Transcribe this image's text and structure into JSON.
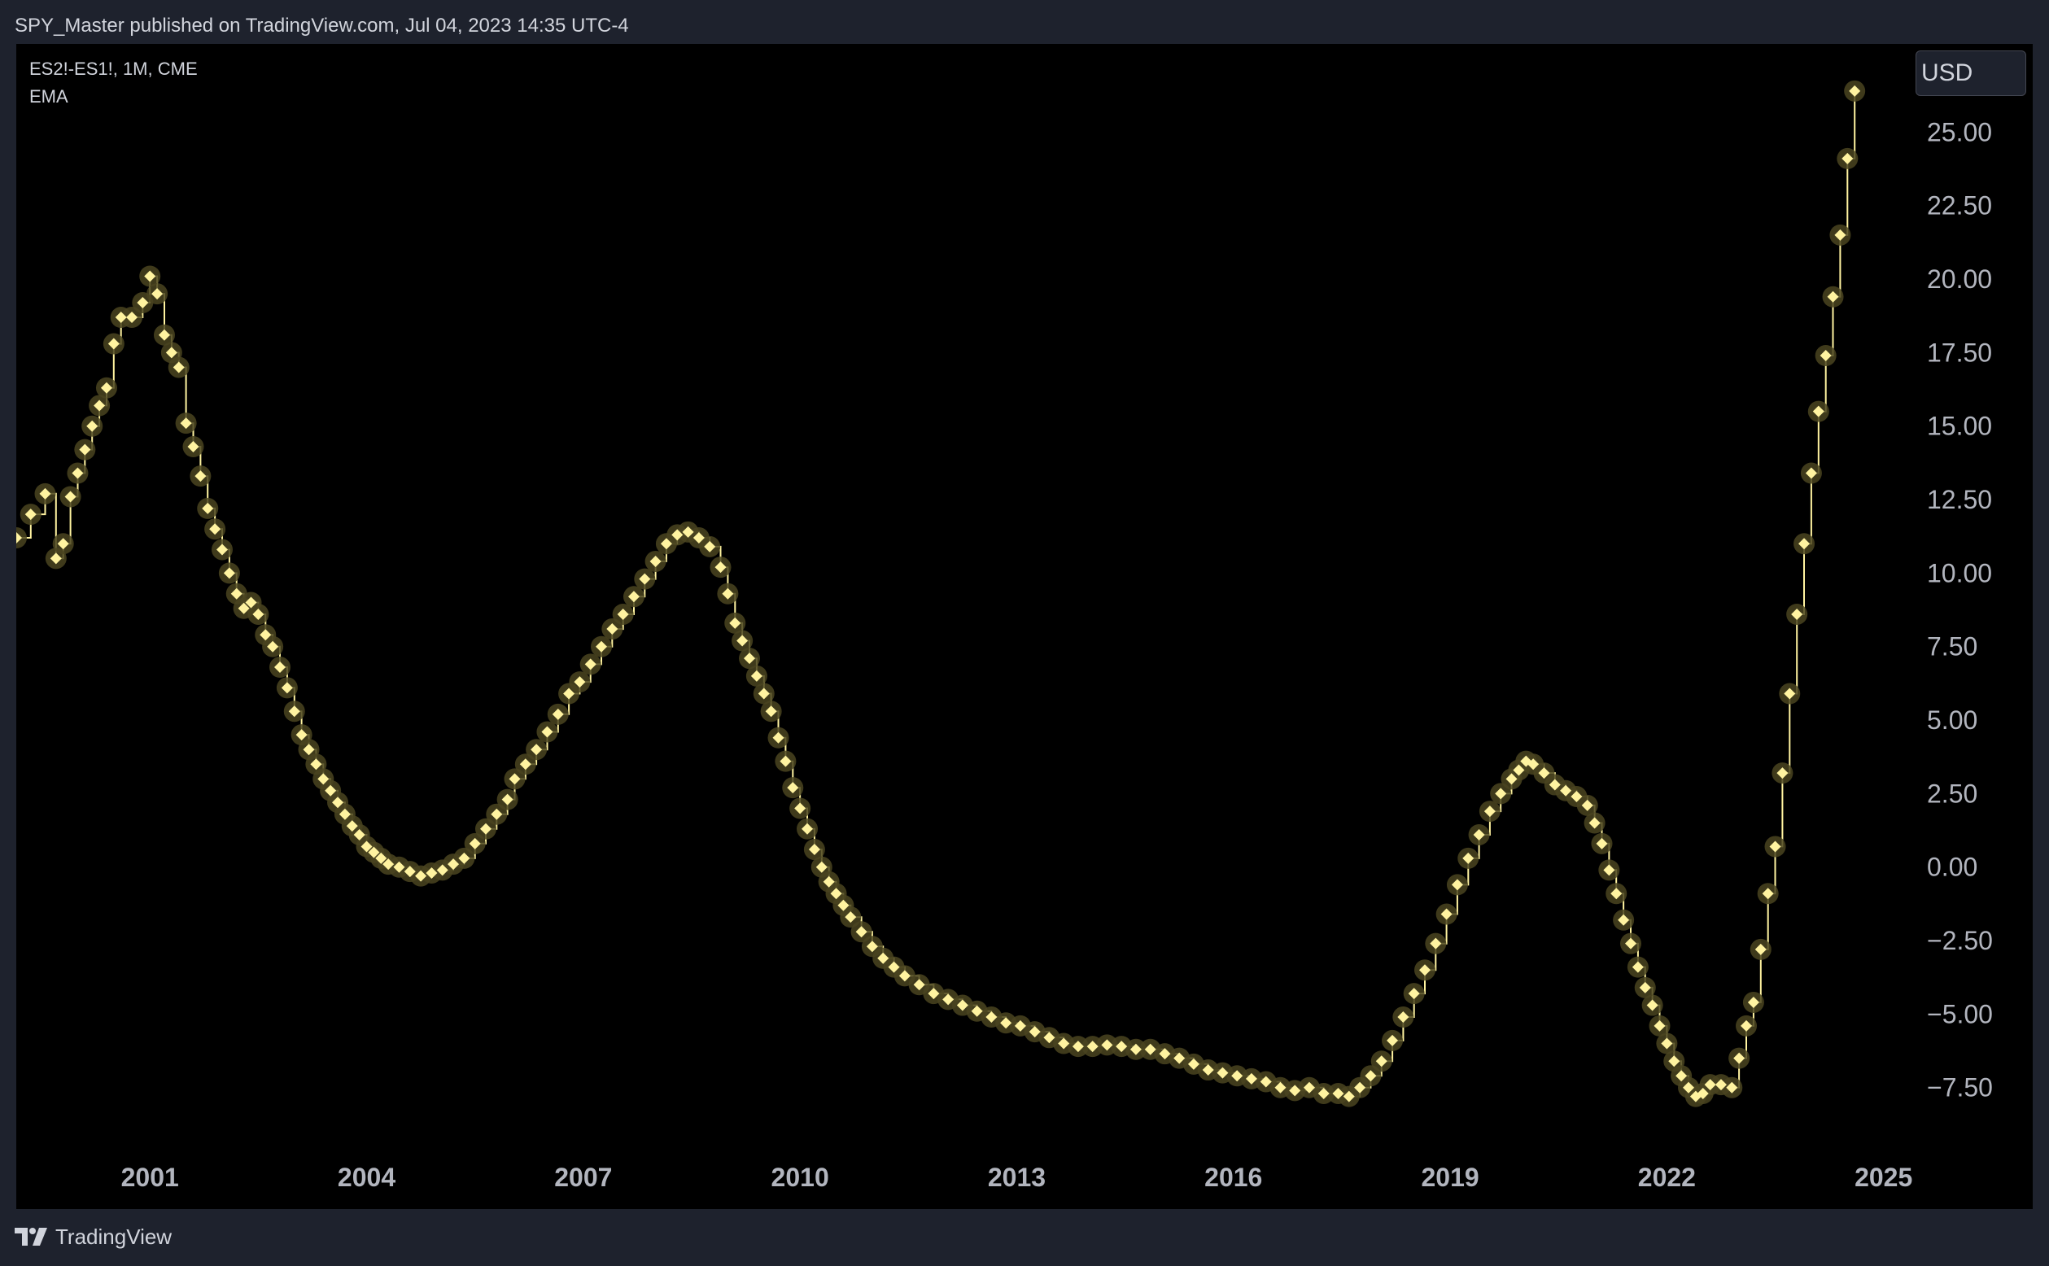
{
  "header": {
    "published_text": "SPY_Master published on TradingView.com, Jul 04, 2023 14:35 UTC-4"
  },
  "legend": {
    "symbol": "ES2!-ES1!, 1M, CME",
    "indicator": "EMA"
  },
  "price_scale": {
    "currency": "USD"
  },
  "footer": {
    "brand": "TradingView",
    "logo_icon": "tradingview-logo-icon"
  },
  "colors": {
    "background": "#1e222d",
    "plot_background": "#000000",
    "line": "#fff3a0",
    "marker_glow": "#4a4420",
    "text": "#d1d4dc",
    "axis_text": "#b2b5be"
  },
  "chart_data": {
    "type": "line",
    "title": "",
    "xlabel": "",
    "ylabel": "",
    "x_ticks": [
      "2001",
      "2004",
      "2007",
      "2010",
      "2013",
      "2016",
      "2019",
      "2022",
      "2025"
    ],
    "y_ticks": [
      "25.00",
      "22.50",
      "20.00",
      "17.50",
      "15.00",
      "12.50",
      "10.00",
      "7.50",
      "5.00",
      "2.50",
      "0.00",
      "−2.50",
      "−5.00",
      "−7.50"
    ],
    "xlim": [
      1999.7,
      2025.7
    ],
    "ylim": [
      -9.5,
      28.0
    ],
    "grid": false,
    "series": [
      {
        "marker": "diamond",
        "points": [
          [
            1999.7,
            11.2
          ],
          [
            1999.9,
            12.0
          ],
          [
            2000.1,
            12.7
          ],
          [
            2000.25,
            10.5
          ],
          [
            2000.35,
            11.0
          ],
          [
            2000.45,
            12.6
          ],
          [
            2000.55,
            13.4
          ],
          [
            2000.65,
            14.2
          ],
          [
            2000.75,
            15.0
          ],
          [
            2000.85,
            15.7
          ],
          [
            2000.95,
            16.3
          ],
          [
            2001.05,
            17.8
          ],
          [
            2001.15,
            18.7
          ],
          [
            2001.3,
            18.7
          ],
          [
            2001.45,
            19.2
          ],
          [
            2001.55,
            20.1
          ],
          [
            2001.65,
            19.5
          ],
          [
            2001.75,
            18.1
          ],
          [
            2001.85,
            17.5
          ],
          [
            2001.95,
            17.0
          ],
          [
            2002.05,
            15.1
          ],
          [
            2002.15,
            14.3
          ],
          [
            2002.25,
            13.3
          ],
          [
            2002.35,
            12.2
          ],
          [
            2002.45,
            11.5
          ],
          [
            2002.55,
            10.8
          ],
          [
            2002.65,
            10.0
          ],
          [
            2002.75,
            9.3
          ],
          [
            2002.85,
            8.8
          ],
          [
            2002.95,
            9.0
          ],
          [
            2003.05,
            8.6
          ],
          [
            2003.15,
            7.9
          ],
          [
            2003.25,
            7.5
          ],
          [
            2003.35,
            6.8
          ],
          [
            2003.45,
            6.1
          ],
          [
            2003.55,
            5.3
          ],
          [
            2003.65,
            4.5
          ],
          [
            2003.75,
            4.0
          ],
          [
            2003.85,
            3.5
          ],
          [
            2003.95,
            3.0
          ],
          [
            2004.05,
            2.6
          ],
          [
            2004.15,
            2.2
          ],
          [
            2004.25,
            1.8
          ],
          [
            2004.35,
            1.4
          ],
          [
            2004.45,
            1.1
          ],
          [
            2004.55,
            0.7
          ],
          [
            2004.65,
            0.5
          ],
          [
            2004.75,
            0.3
          ],
          [
            2004.85,
            0.1
          ],
          [
            2005.0,
            0.0
          ],
          [
            2005.15,
            -0.15
          ],
          [
            2005.3,
            -0.3
          ],
          [
            2005.45,
            -0.2
          ],
          [
            2005.6,
            -0.1
          ],
          [
            2005.75,
            0.1
          ],
          [
            2005.9,
            0.3
          ],
          [
            2006.05,
            0.8
          ],
          [
            2006.2,
            1.3
          ],
          [
            2006.35,
            1.8
          ],
          [
            2006.5,
            2.3
          ],
          [
            2006.6,
            3.0
          ],
          [
            2006.75,
            3.5
          ],
          [
            2006.9,
            4.0
          ],
          [
            2007.05,
            4.6
          ],
          [
            2007.2,
            5.2
          ],
          [
            2007.35,
            5.9
          ],
          [
            2007.5,
            6.3
          ],
          [
            2007.65,
            6.9
          ],
          [
            2007.8,
            7.5
          ],
          [
            2007.95,
            8.1
          ],
          [
            2008.1,
            8.6
          ],
          [
            2008.25,
            9.2
          ],
          [
            2008.4,
            9.8
          ],
          [
            2008.55,
            10.4
          ],
          [
            2008.7,
            11.0
          ],
          [
            2008.85,
            11.3
          ],
          [
            2009.0,
            11.4
          ],
          [
            2009.15,
            11.2
          ],
          [
            2009.3,
            10.9
          ],
          [
            2009.45,
            10.2
          ],
          [
            2009.55,
            9.3
          ],
          [
            2009.65,
            8.3
          ],
          [
            2009.75,
            7.7
          ],
          [
            2009.85,
            7.1
          ],
          [
            2009.95,
            6.5
          ],
          [
            2010.05,
            5.9
          ],
          [
            2010.15,
            5.3
          ],
          [
            2010.25,
            4.4
          ],
          [
            2010.35,
            3.6
          ],
          [
            2010.45,
            2.7
          ],
          [
            2010.55,
            2.0
          ],
          [
            2010.65,
            1.3
          ],
          [
            2010.75,
            0.6
          ],
          [
            2010.85,
            0.0
          ],
          [
            2010.95,
            -0.5
          ],
          [
            2011.05,
            -0.9
          ],
          [
            2011.15,
            -1.3
          ],
          [
            2011.25,
            -1.7
          ],
          [
            2011.4,
            -2.2
          ],
          [
            2011.55,
            -2.7
          ],
          [
            2011.7,
            -3.1
          ],
          [
            2011.85,
            -3.4
          ],
          [
            2012.0,
            -3.7
          ],
          [
            2012.2,
            -4.0
          ],
          [
            2012.4,
            -4.3
          ],
          [
            2012.6,
            -4.5
          ],
          [
            2012.8,
            -4.7
          ],
          [
            2013.0,
            -4.9
          ],
          [
            2013.2,
            -5.1
          ],
          [
            2013.4,
            -5.3
          ],
          [
            2013.6,
            -5.4
          ],
          [
            2013.8,
            -5.6
          ],
          [
            2014.0,
            -5.8
          ],
          [
            2014.2,
            -6.0
          ],
          [
            2014.4,
            -6.1
          ],
          [
            2014.6,
            -6.1
          ],
          [
            2014.8,
            -6.05
          ],
          [
            2015.0,
            -6.1
          ],
          [
            2015.2,
            -6.2
          ],
          [
            2015.4,
            -6.2
          ],
          [
            2015.6,
            -6.35
          ],
          [
            2015.8,
            -6.5
          ],
          [
            2016.0,
            -6.7
          ],
          [
            2016.2,
            -6.9
          ],
          [
            2016.4,
            -7.0
          ],
          [
            2016.6,
            -7.1
          ],
          [
            2016.8,
            -7.2
          ],
          [
            2017.0,
            -7.3
          ],
          [
            2017.2,
            -7.5
          ],
          [
            2017.4,
            -7.6
          ],
          [
            2017.6,
            -7.5
          ],
          [
            2017.8,
            -7.7
          ],
          [
            2018.0,
            -7.7
          ],
          [
            2018.15,
            -7.8
          ],
          [
            2018.3,
            -7.5
          ],
          [
            2018.45,
            -7.1
          ],
          [
            2018.6,
            -6.6
          ],
          [
            2018.75,
            -5.9
          ],
          [
            2018.9,
            -5.1
          ],
          [
            2019.05,
            -4.3
          ],
          [
            2019.2,
            -3.5
          ],
          [
            2019.35,
            -2.6
          ],
          [
            2019.5,
            -1.6
          ],
          [
            2019.65,
            -0.6
          ],
          [
            2019.8,
            0.3
          ],
          [
            2019.95,
            1.1
          ],
          [
            2020.1,
            1.9
          ],
          [
            2020.25,
            2.5
          ],
          [
            2020.4,
            3.0
          ],
          [
            2020.5,
            3.3
          ],
          [
            2020.6,
            3.6
          ],
          [
            2020.7,
            3.5
          ],
          [
            2020.85,
            3.2
          ],
          [
            2021.0,
            2.8
          ],
          [
            2021.15,
            2.6
          ],
          [
            2021.3,
            2.4
          ],
          [
            2021.45,
            2.1
          ],
          [
            2021.55,
            1.5
          ],
          [
            2021.65,
            0.8
          ],
          [
            2021.75,
            -0.1
          ],
          [
            2021.85,
            -0.9
          ],
          [
            2021.95,
            -1.8
          ],
          [
            2022.05,
            -2.6
          ],
          [
            2022.15,
            -3.4
          ],
          [
            2022.25,
            -4.1
          ],
          [
            2022.35,
            -4.7
          ],
          [
            2022.45,
            -5.4
          ],
          [
            2022.55,
            -6.0
          ],
          [
            2022.65,
            -6.6
          ],
          [
            2022.75,
            -7.1
          ],
          [
            2022.85,
            -7.5
          ],
          [
            2022.95,
            -7.8
          ],
          [
            2023.05,
            -7.7
          ],
          [
            2023.15,
            -7.4
          ],
          [
            2023.3,
            -7.4
          ],
          [
            2023.45,
            -7.5
          ],
          [
            2023.55,
            -6.5
          ],
          [
            2023.65,
            -5.4
          ],
          [
            2023.75,
            -4.6
          ],
          [
            2023.85,
            -2.8
          ],
          [
            2023.95,
            -0.9
          ],
          [
            2024.05,
            0.7
          ],
          [
            2024.15,
            3.2
          ],
          [
            2024.25,
            5.9
          ],
          [
            2024.35,
            8.6
          ],
          [
            2024.45,
            11.0
          ],
          [
            2024.55,
            13.4
          ],
          [
            2024.65,
            15.5
          ],
          [
            2024.75,
            17.4
          ],
          [
            2024.85,
            19.4
          ],
          [
            2024.95,
            21.5
          ],
          [
            2025.05,
            24.1
          ],
          [
            2025.15,
            26.4
          ]
        ]
      }
    ]
  }
}
